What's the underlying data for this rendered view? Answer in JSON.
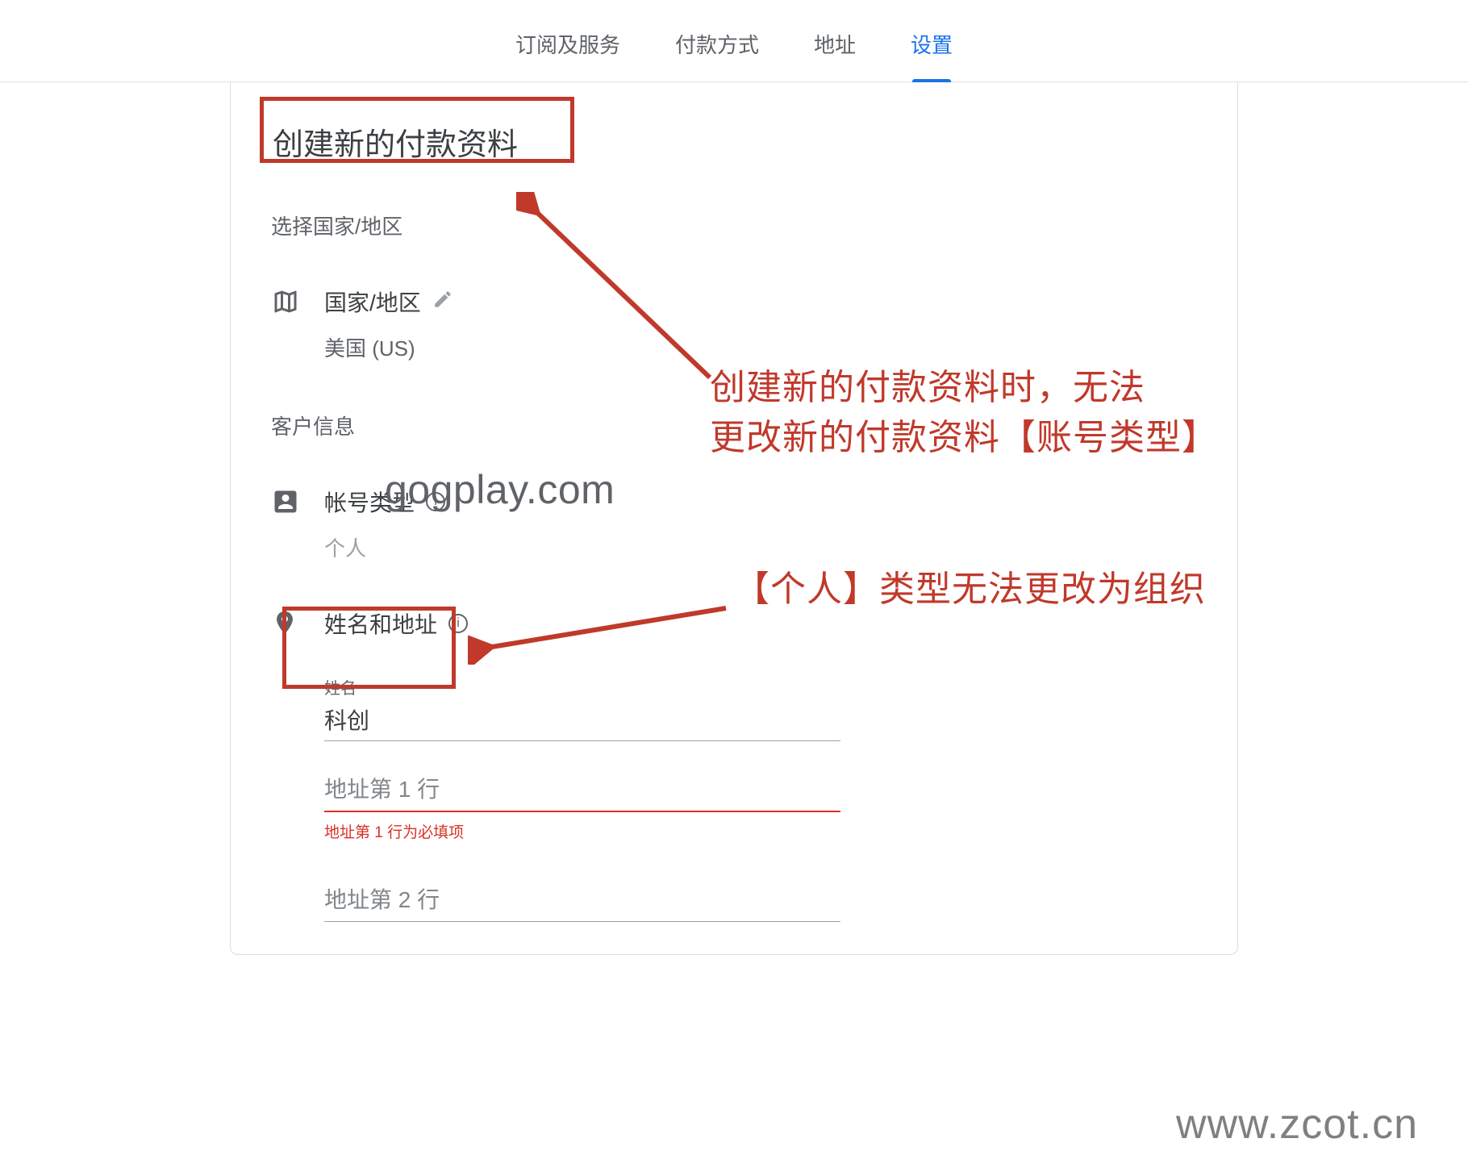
{
  "nav": {
    "tabs": [
      {
        "label": "订阅及服务"
      },
      {
        "label": "付款方式"
      },
      {
        "label": "地址"
      },
      {
        "label": "设置"
      }
    ],
    "active_index": 3
  },
  "page": {
    "title": "创建新的付款资料",
    "select_country_label": "选择国家/地区",
    "country_field_label": "国家/地区",
    "country_value": "美国 (US)",
    "customer_info_header": "客户信息",
    "account_type_label": "帐号类型",
    "account_type_value": "个人",
    "name_address_label": "姓名和地址",
    "name_label": "姓名",
    "name_value": "科创",
    "address1_placeholder": "地址第 1 行",
    "address1_value": "",
    "address1_error": "地址第 1 行为必填项",
    "address2_placeholder": "地址第 2 行",
    "address2_value": ""
  },
  "annotations": {
    "note1_line1": "创建新的付款资料时，无法",
    "note1_line2": "更改新的付款资料【账号类型】",
    "note2": "【个人】类型无法更改为组织"
  },
  "watermarks": {
    "gogplay": "gogplay.com",
    "zcot": "www.zcot.cn"
  },
  "colors": {
    "annotation_red": "#c0392b",
    "accent_blue": "#1a73e8",
    "error_red": "#d93025"
  }
}
